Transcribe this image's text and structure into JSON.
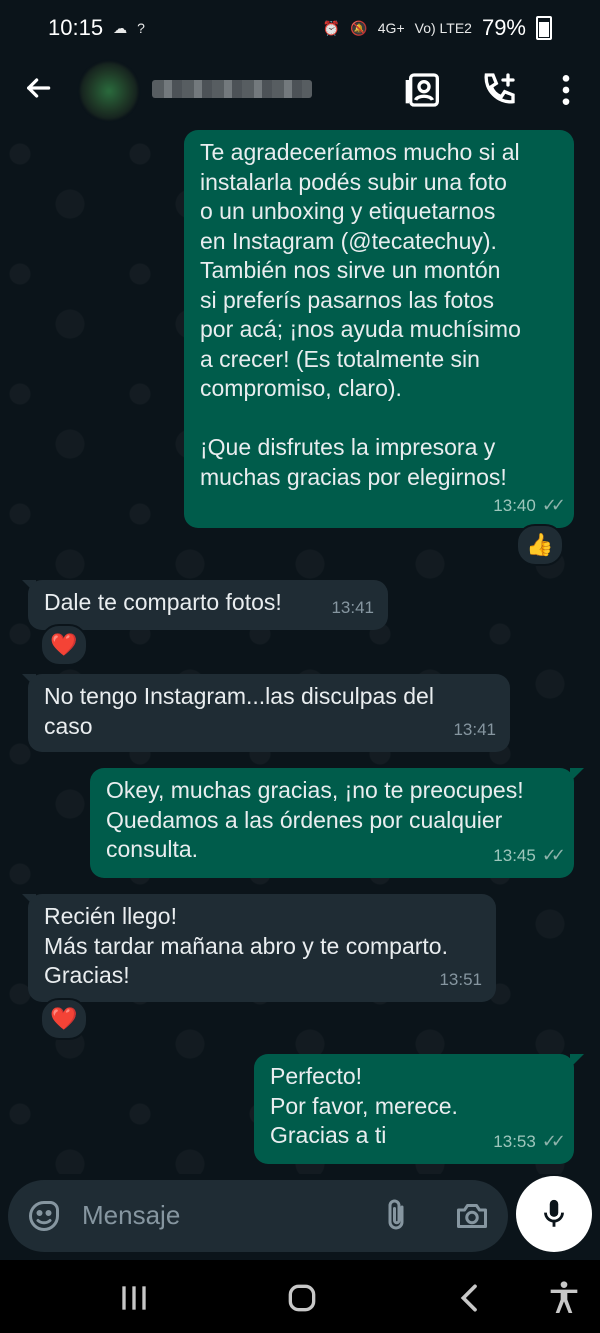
{
  "status_bar": {
    "time": "10:15",
    "signal_hint": "?",
    "network_1": "4G+",
    "network_2": "Vo) LTE2",
    "battery": "79%"
  },
  "header": {
    "contact_name": ""
  },
  "messages": [
    {
      "direction": "out",
      "text": "Te agradeceríamos mucho si al\ninstalarla podés subir una foto\no un unboxing y etiquetarnos\nen Instagram (@tecatechuy).\nTambién nos sirve un montón\nsi preferís pasarnos las fotos\npor acá; ¡nos ayuda muchísimo\na crecer!  (Es totalmente sin\ncompromiso, claro).\n\n¡Que disfrutes la impresora y\nmuchas gracias por elegirnos!",
      "time": "13:40",
      "reaction": "👍"
    },
    {
      "direction": "in",
      "text": "Dale te comparto fotos!",
      "time": "13:41",
      "reaction": "❤️"
    },
    {
      "direction": "in",
      "text": "No tengo Instagram...las disculpas del\ncaso",
      "time": "13:41"
    },
    {
      "direction": "out",
      "text": "Okey, muchas gracias, ¡no te preocupes!\nQuedamos a las órdenes por cualquier\nconsulta.",
      "time": "13:45"
    },
    {
      "direction": "in",
      "text": "Recién llego!\nMás tardar mañana abro y te comparto.\nGracias!",
      "time": "13:51",
      "reaction": "❤️"
    },
    {
      "direction": "out",
      "text": "Perfecto!\nPor favor, merece.\nGracias a ti",
      "time": "13:53"
    }
  ],
  "composer": {
    "placeholder": "Mensaje"
  },
  "colors": {
    "background": "#0b141a",
    "outgoing_bubble": "#005c4b",
    "incoming_bubble": "#1f2c34"
  },
  "icons": [
    "back-arrow-icon",
    "contact-card-icon",
    "add-call-icon",
    "more-vert-icon",
    "sticker-icon",
    "attach-icon",
    "camera-icon",
    "mic-icon",
    "recents-icon",
    "home-icon",
    "back-icon",
    "accessibility-icon"
  ]
}
